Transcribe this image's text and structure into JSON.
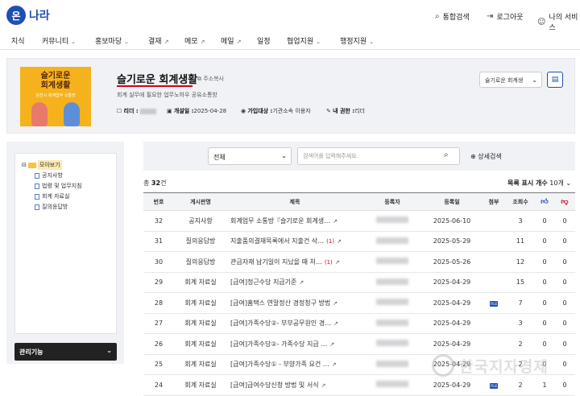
{
  "header": {
    "logo_mark": "온",
    "logo_text": "나라",
    "util": [
      {
        "label": "통합검색",
        "icon": "search-icon"
      },
      {
        "label": "로그아웃",
        "icon": "logout-icon"
      },
      {
        "label": "나의 서비스",
        "icon": "user-icon"
      }
    ]
  },
  "gnb": [
    {
      "label": "지식",
      "suffix": ""
    },
    {
      "label": "커뮤니티",
      "suffix": "⌄"
    },
    {
      "label": "홍보마당",
      "suffix": "⌄"
    },
    {
      "label": "결재",
      "suffix": "↗"
    },
    {
      "label": "메모",
      "suffix": "↗"
    },
    {
      "label": "메일",
      "suffix": "↗"
    },
    {
      "label": "일정",
      "suffix": ""
    },
    {
      "label": "협업지원",
      "suffix": "⌄"
    },
    {
      "label": "행정지원",
      "suffix": "⌄"
    }
  ],
  "club": {
    "thumb_title": "슬기로운\n회계생활",
    "thumb_subtitle": "김천시 회계업무 소통방",
    "title": "슬기로운 회계생활",
    "copy_address": "주소복사",
    "description": "회계 실무에 필요한 업무노하우 공유소통방",
    "leader_label": "리더 :",
    "opened_label": "개설일 :",
    "opened_value": "2025-04-28",
    "join_label": "가입대상 :",
    "join_value": "기관소속 이용자",
    "role_label": "내 권한 :",
    "role_value": "리더",
    "select_value": "슬기로운 회계생"
  },
  "sidebar": {
    "root": "모아보기",
    "items": [
      "공지사항",
      "법령 및 업무지침",
      "회계 자료실",
      "질의응답방"
    ],
    "admin": "관리기능"
  },
  "search": {
    "scope": "전체",
    "placeholder": "검색어를 입력해주세요.",
    "advanced": "상세검색"
  },
  "list": {
    "total_prefix": "총",
    "total_count": "32",
    "total_suffix": "건",
    "perpage_label": "목록 표시 개수",
    "perpage_value": "10개",
    "columns": {
      "no": "번호",
      "board": "게시판명",
      "title": "제목",
      "author": "등록자",
      "date": "등록일",
      "attach": "첨부",
      "views": "조회수"
    },
    "rows": [
      {
        "no": "32",
        "board": "공지사항",
        "title": "회계업무 소통방『슬기로운 회계생…",
        "comments": "",
        "date": "2025-06-10",
        "attach": false,
        "views": "3",
        "like": "0",
        "dislike": "0"
      },
      {
        "no": "31",
        "board": "질의응답방",
        "title": "지출품의결재목록에서 지출건 삭…",
        "comments": "(1)",
        "date": "2025-05-29",
        "attach": false,
        "views": "11",
        "like": "0",
        "dislike": "0"
      },
      {
        "no": "30",
        "board": "질의응답방",
        "title": "관급자재 납기일이 지났을 때 처…",
        "comments": "(1)",
        "date": "2025-05-26",
        "attach": false,
        "views": "12",
        "like": "0",
        "dislike": "0"
      },
      {
        "no": "29",
        "board": "회계 자료실",
        "title": "[급여]정근수당 지급기준",
        "comments": "",
        "date": "2025-04-29",
        "attach": false,
        "views": "15",
        "like": "0",
        "dislike": "0"
      },
      {
        "no": "28",
        "board": "회계 자료실",
        "title": "[급여]홈택스 연말정산 경정청구 방법",
        "comments": "",
        "date": "2025-04-29",
        "attach": true,
        "views": "7",
        "like": "0",
        "dislike": "0"
      },
      {
        "no": "27",
        "board": "회계 자료실",
        "title": "[급여]가족수당②- 부부공무원인 경…",
        "comments": "",
        "date": "2025-04-29",
        "attach": false,
        "views": "3",
        "like": "0",
        "dislike": "0"
      },
      {
        "no": "26",
        "board": "회계 자료실",
        "title": "[급여]가족수당②- 가족수당 지급 …",
        "comments": "",
        "date": "2025-04-29",
        "attach": false,
        "views": "2",
        "like": "0",
        "dislike": "0"
      },
      {
        "no": "25",
        "board": "회계 자료실",
        "title": "[급여]가족수당① - 부양가족 요건 …",
        "comments": "",
        "date": "2025-04-29",
        "attach": false,
        "views": "2",
        "like": "0",
        "dislike": "0"
      },
      {
        "no": "24",
        "board": "회계 자료실",
        "title": "[급여]급여수당신청 방법 및 서식",
        "comments": "",
        "date": "2025-04-29",
        "attach": true,
        "views": "2",
        "like": "1",
        "dislike": "0"
      }
    ]
  },
  "watermark": "한국지자경제"
}
